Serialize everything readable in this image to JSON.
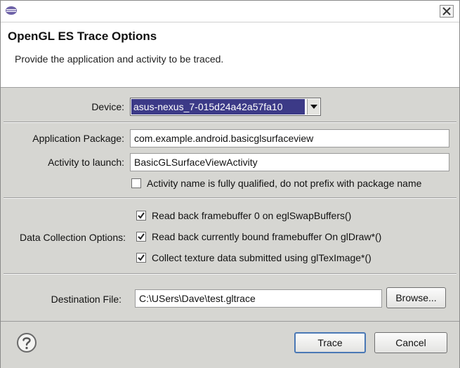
{
  "window": {
    "close_label": "X"
  },
  "header": {
    "title": "OpenGL ES Trace Options",
    "description": "Provide the application and activity to be traced."
  },
  "device": {
    "label": "Device:",
    "selected": "asus-nexus_7-015d24a42a57fa10"
  },
  "app_package": {
    "label": "Application Package:",
    "value": "com.example.android.basicglsurfaceview"
  },
  "activity": {
    "label": "Activity to launch:",
    "value": "BasicGLSurfaceViewActivity",
    "qualified_label": "Activity name is fully qualified, do not prefix with package name",
    "qualified_checked": false
  },
  "data_collection": {
    "label": "Data Collection Options:",
    "options": [
      {
        "label": "Read back framebuffer 0 on eglSwapBuffers()",
        "checked": true
      },
      {
        "label": "Read back currently bound framebuffer On glDraw*()",
        "checked": true
      },
      {
        "label": "Collect texture data submitted using glTexImage*()",
        "checked": true
      }
    ]
  },
  "destination": {
    "label": "Destination File:",
    "value": "C:\\USers\\Dave\\test.gltrace",
    "browse_label": "Browse..."
  },
  "footer": {
    "help_icon": "question-mark-icon",
    "trace_label": "Trace",
    "cancel_label": "Cancel"
  },
  "colors": {
    "selection_bg": "#3c3a87",
    "dialog_bg": "#d6d6d2",
    "default_button_border": "#4a78b5"
  }
}
